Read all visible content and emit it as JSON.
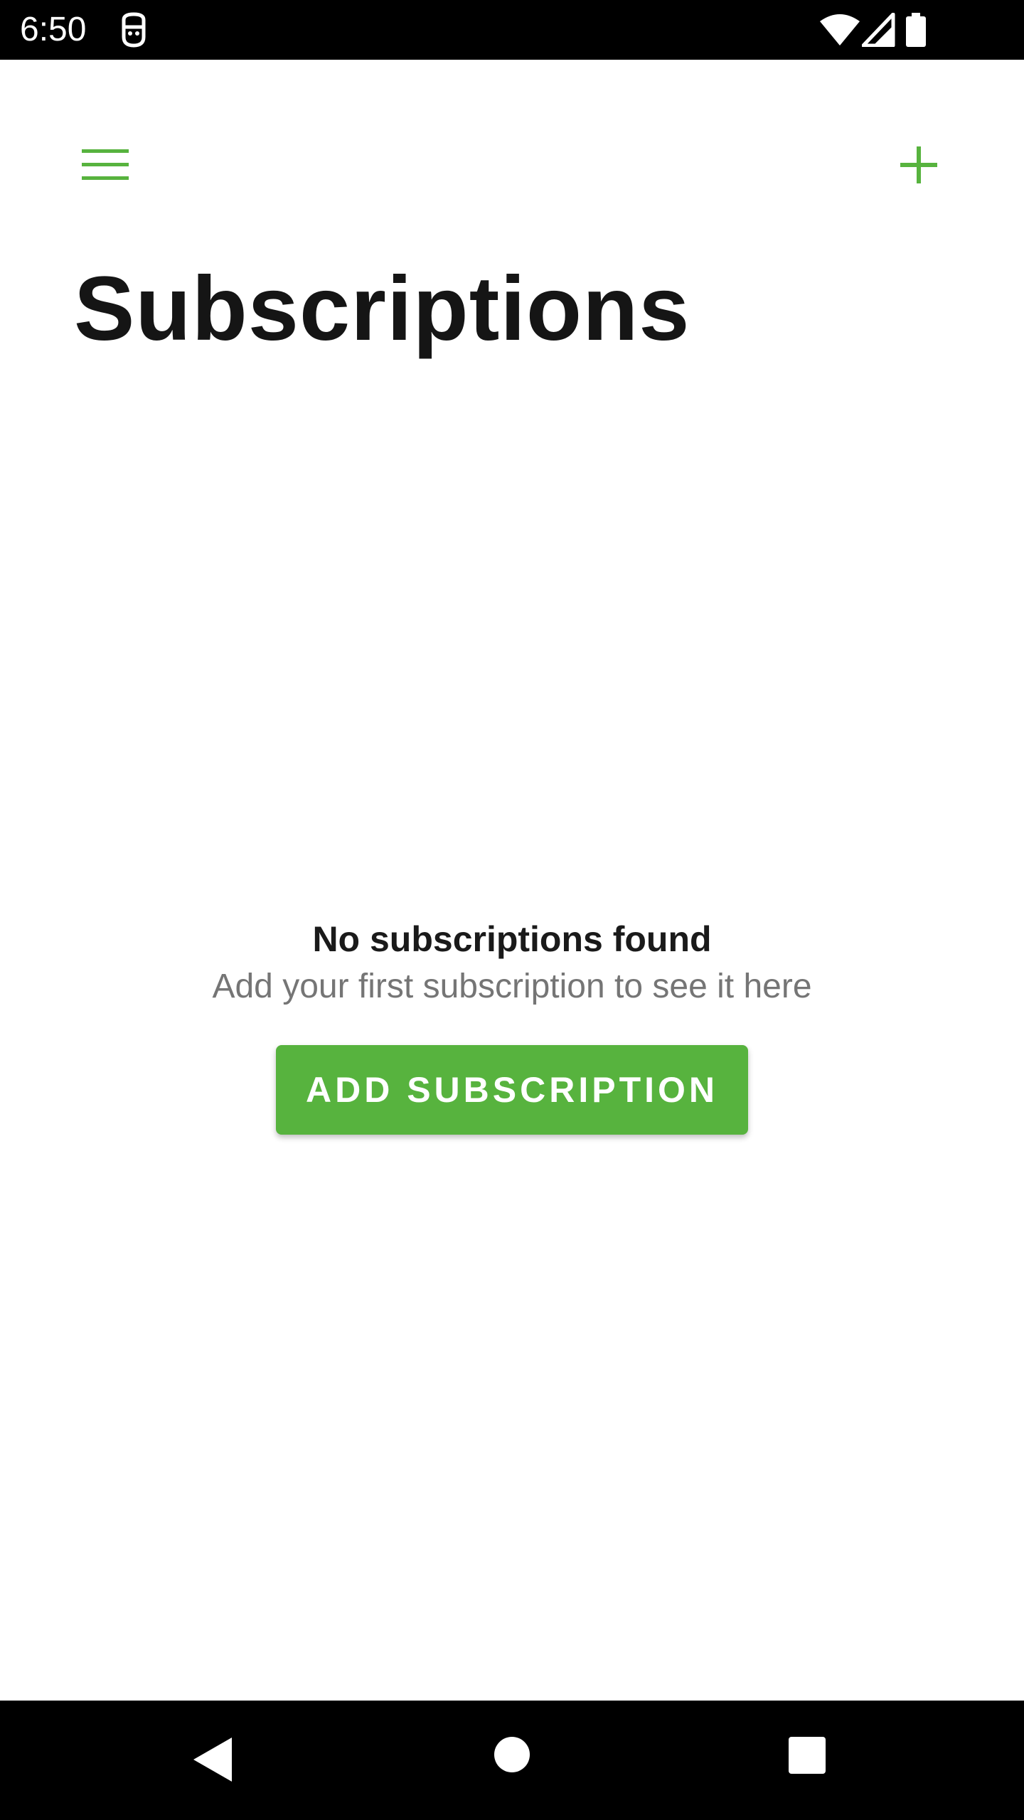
{
  "status_bar": {
    "time": "6:50",
    "app_icon": "subscription-app-icon",
    "wifi_icon": "wifi-icon",
    "signal_icon": "cell-signal-icon",
    "battery_icon": "battery-icon"
  },
  "app_bar": {
    "menu_icon": "hamburger-menu-icon",
    "add_icon": "plus-icon",
    "accent_color": "#57b33e"
  },
  "page": {
    "title": "Subscriptions"
  },
  "empty_state": {
    "title": "No subscriptions found",
    "subtitle": "Add your first subscription to see it here",
    "button_label": "ADD SUBSCRIPTION",
    "button_color": "#57b33e"
  },
  "nav_bar": {
    "back_icon": "back-triangle-icon",
    "home_icon": "home-circle-icon",
    "recents_icon": "recents-square-icon"
  }
}
